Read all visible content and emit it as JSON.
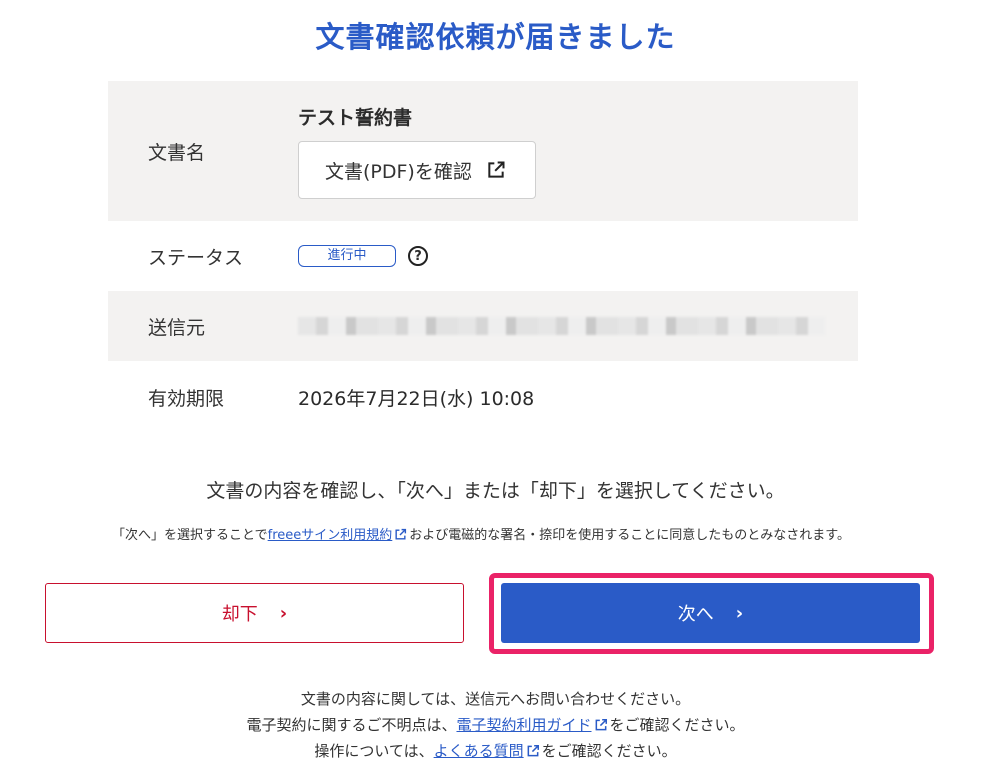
{
  "page": {
    "title": "文書確認依頼が届きました"
  },
  "document_info": {
    "doc_label": "文書名",
    "doc_name": "テスト誓約書",
    "doc_button": "文書(PDF)を確認",
    "status_label": "ステータス",
    "status_badge": "進行中",
    "sender_label": "送信元",
    "expiry_label": "有効期限",
    "expiry_value": "2026年7月22日(水) 10:08"
  },
  "instruction": "文書の内容を確認し、「次へ」または「却下」を選択してください。",
  "consent": {
    "prefix": "「次へ」を選択することで",
    "link": "freeeサイン利用規約",
    "suffix": "および電磁的な署名・捺印を使用することに同意したものとみなされます。"
  },
  "buttons": {
    "reject": "却下",
    "next": "次へ"
  },
  "footer": {
    "line1": "文書の内容に関しては、送信元へお問い合わせください。",
    "line2_prefix": "電子契約に関するご不明点は、",
    "line2_link": "電子契約利用ガイド",
    "line2_suffix": "をご確認ください。",
    "line3_prefix": "操作については、",
    "line3_link": "よくある質問",
    "line3_suffix": "をご確認ください。"
  },
  "colors": {
    "accent": "#2a5bc7",
    "danger": "#c8102e",
    "highlight": "#ea2267",
    "row_bg": "#f3f2f1"
  }
}
